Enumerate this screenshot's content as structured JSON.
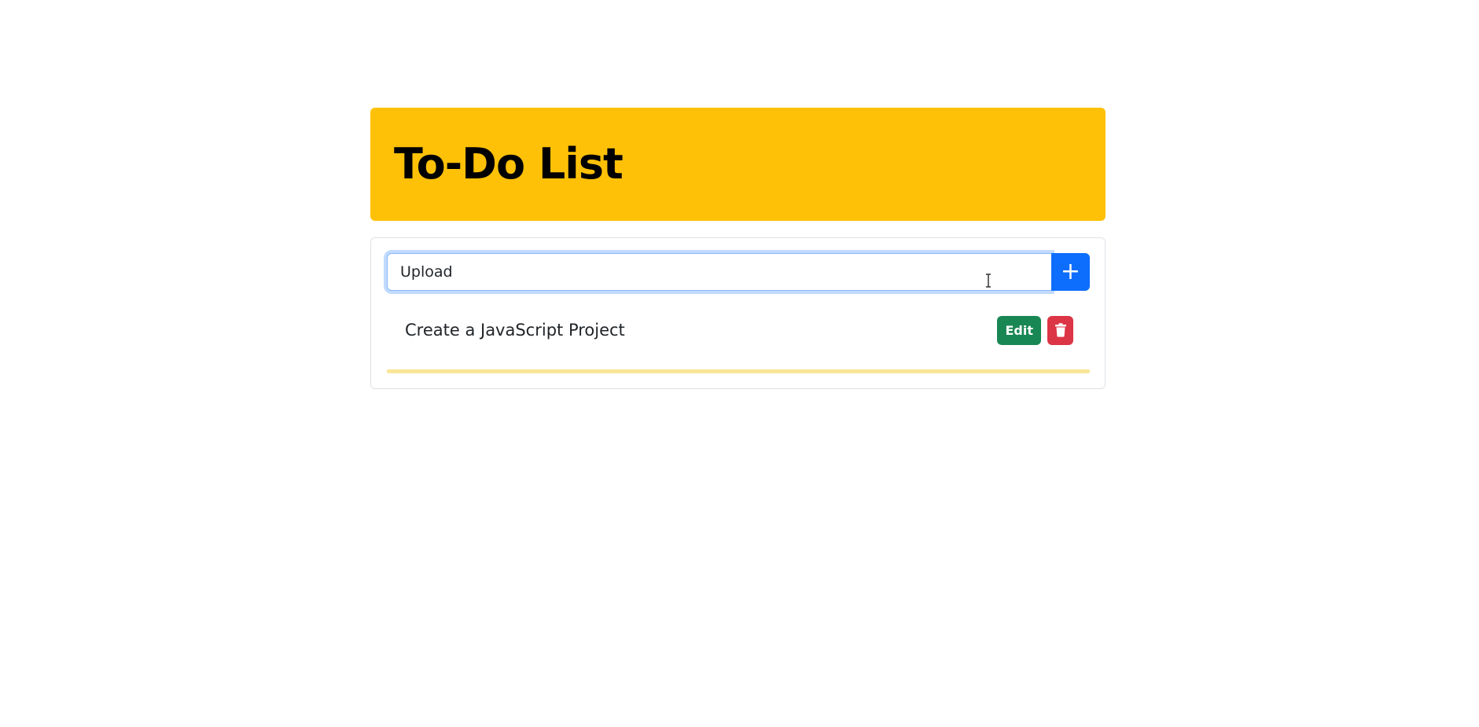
{
  "header": {
    "title": "To-Do List"
  },
  "task_input": {
    "value": "Upload ",
    "placeholder": ""
  },
  "add_button": {
    "label": "+"
  },
  "tasks": [
    {
      "text": "Create a JavaScript Project",
      "edit_label": "Edit",
      "delete_icon": "trash-icon"
    }
  ],
  "colors": {
    "header_bg": "#ffc107",
    "add_button_bg": "#0d6efd",
    "edit_button_bg": "#198754",
    "delete_button_bg": "#dc3545",
    "divider": "#f9e598"
  },
  "icons": {
    "add": "plus-icon",
    "delete": "trash-icon",
    "cursor": "text-cursor-icon"
  }
}
